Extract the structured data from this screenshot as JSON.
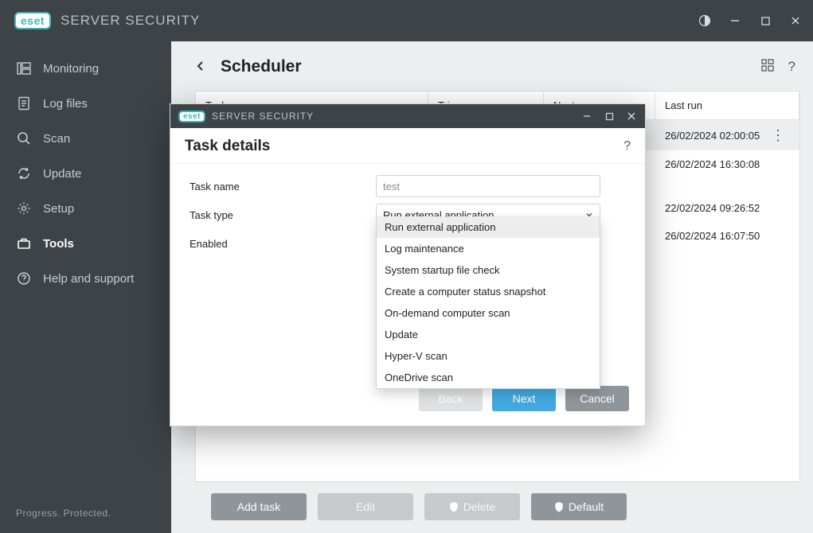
{
  "app": {
    "brand": "eset",
    "title": "SERVER SECURITY"
  },
  "sidebar": {
    "items": [
      {
        "label": "Monitoring"
      },
      {
        "label": "Log files"
      },
      {
        "label": "Scan"
      },
      {
        "label": "Update"
      },
      {
        "label": "Setup"
      },
      {
        "label": "Tools"
      },
      {
        "label": "Help and support"
      }
    ],
    "footer": "Progress. Protected."
  },
  "page": {
    "title": "Scheduler",
    "columns": {
      "task": "Task",
      "triggers": "Triggers",
      "next_run": "Next run",
      "last_run": "Last run"
    },
    "rows": [
      {
        "last_run": "26/02/2024 02:00:05",
        "highlighted": true
      },
      {
        "last_run": "26/02/2024 16:30:08"
      },
      {
        "last_run": ""
      },
      {
        "last_run": "22/02/2024 09:26:52"
      },
      {
        "last_run": "26/02/2024 16:07:50"
      }
    ],
    "buttons": {
      "add": "Add task",
      "edit": "Edit",
      "delete": "Delete",
      "default": "Default"
    }
  },
  "modal": {
    "app_title": "SERVER SECURITY",
    "brand": "eset",
    "title": "Task details",
    "fields": {
      "task_name_label": "Task name",
      "task_name_value": "test",
      "task_type_label": "Task type",
      "task_type_value": "Run external application",
      "enabled_label": "Enabled"
    },
    "dropdown_options": [
      "Run external application",
      "Log maintenance",
      "System startup file check",
      "Create a computer status snapshot",
      "On-demand computer scan",
      "Update",
      "Hyper-V scan",
      "OneDrive scan"
    ],
    "buttons": {
      "back": "Back",
      "next": "Next",
      "cancel": "Cancel"
    }
  }
}
